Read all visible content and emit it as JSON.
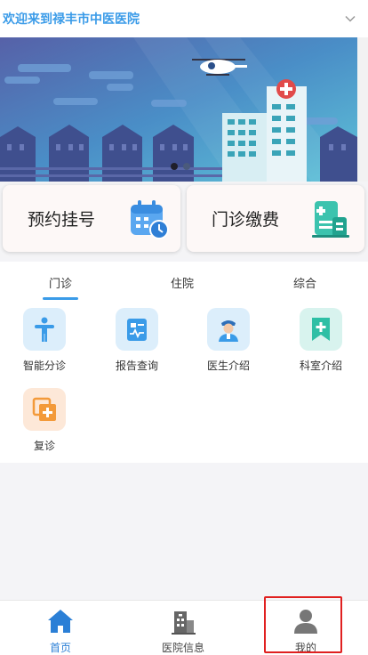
{
  "header": {
    "title": "欢迎来到禄丰市中医医院",
    "chevron_icon": "chevron-down-icon"
  },
  "banner": {
    "slides": 2,
    "active_slide": 1
  },
  "quick_actions": [
    {
      "label": "预约挂号",
      "icon": "calendar-clock-icon"
    },
    {
      "label": "门诊缴费",
      "icon": "document-payment-icon"
    }
  ],
  "tabs": [
    {
      "label": "门诊",
      "active": true
    },
    {
      "label": "住院",
      "active": false
    },
    {
      "label": "综合",
      "active": false
    }
  ],
  "features": [
    {
      "label": "智能分诊",
      "icon": "person-standing-icon",
      "bg": "#dceefb",
      "fg": "#3a9be8"
    },
    {
      "label": "报告查询",
      "icon": "report-icon",
      "bg": "#dceefb",
      "fg": "#3a9be8"
    },
    {
      "label": "医生介绍",
      "icon": "doctor-icon",
      "bg": "#dceefb",
      "fg": "#3a9be8"
    },
    {
      "label": "科室介绍",
      "icon": "bookmark-plus-icon",
      "bg": "#d8f3ee",
      "fg": "#2ebfa5"
    },
    {
      "label": "复诊",
      "icon": "copy-plus-icon",
      "bg": "#fde8d8",
      "fg": "#f39a3a"
    }
  ],
  "bottom_nav": [
    {
      "label": "首页",
      "icon": "home-icon",
      "active": true
    },
    {
      "label": "医院信息",
      "icon": "hospital-building-icon",
      "active": false
    },
    {
      "label": "我的",
      "icon": "user-icon",
      "active": false
    }
  ],
  "colors": {
    "accent": "#3a9be8",
    "highlight": "#e02020"
  }
}
